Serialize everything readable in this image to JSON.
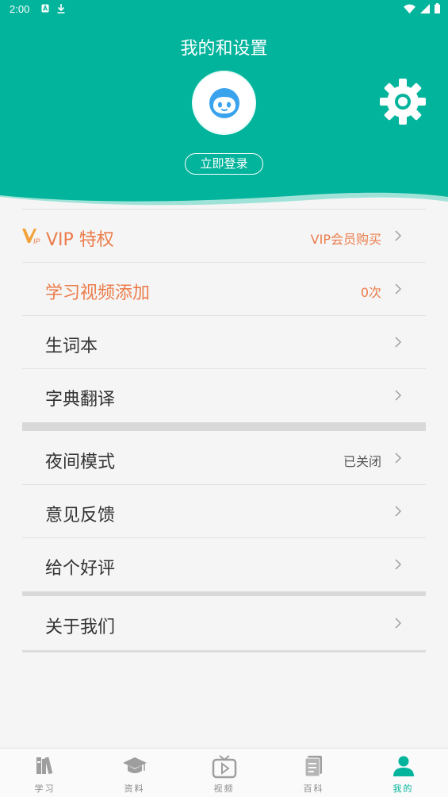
{
  "status_bar": {
    "time": "2:00"
  },
  "header": {
    "title": "我的和设置",
    "login_label": "立即登录"
  },
  "colors": {
    "accent": "#03b49c",
    "highlight": "#ec7c4b"
  },
  "menu": {
    "vip": {
      "label": "VIP 特权",
      "value": "VIP会员购买",
      "icon": "vip-icon"
    },
    "video": {
      "label": "学习视频添加",
      "value": "0次"
    },
    "vocab": {
      "label": "生词本"
    },
    "dict": {
      "label": "字典翻译"
    },
    "night": {
      "label": "夜间模式",
      "value": "已关闭"
    },
    "feedback": {
      "label": "意见反馈"
    },
    "rate": {
      "label": "给个好评"
    },
    "about": {
      "label": "关于我们"
    }
  },
  "tabs": [
    {
      "label": "学习",
      "icon": "books-icon"
    },
    {
      "label": "资料",
      "icon": "graduation-cap-icon"
    },
    {
      "label": "视频",
      "icon": "tv-play-icon"
    },
    {
      "label": "百科",
      "icon": "document-icon"
    },
    {
      "label": "我的",
      "icon": "person-icon",
      "active": true
    }
  ]
}
